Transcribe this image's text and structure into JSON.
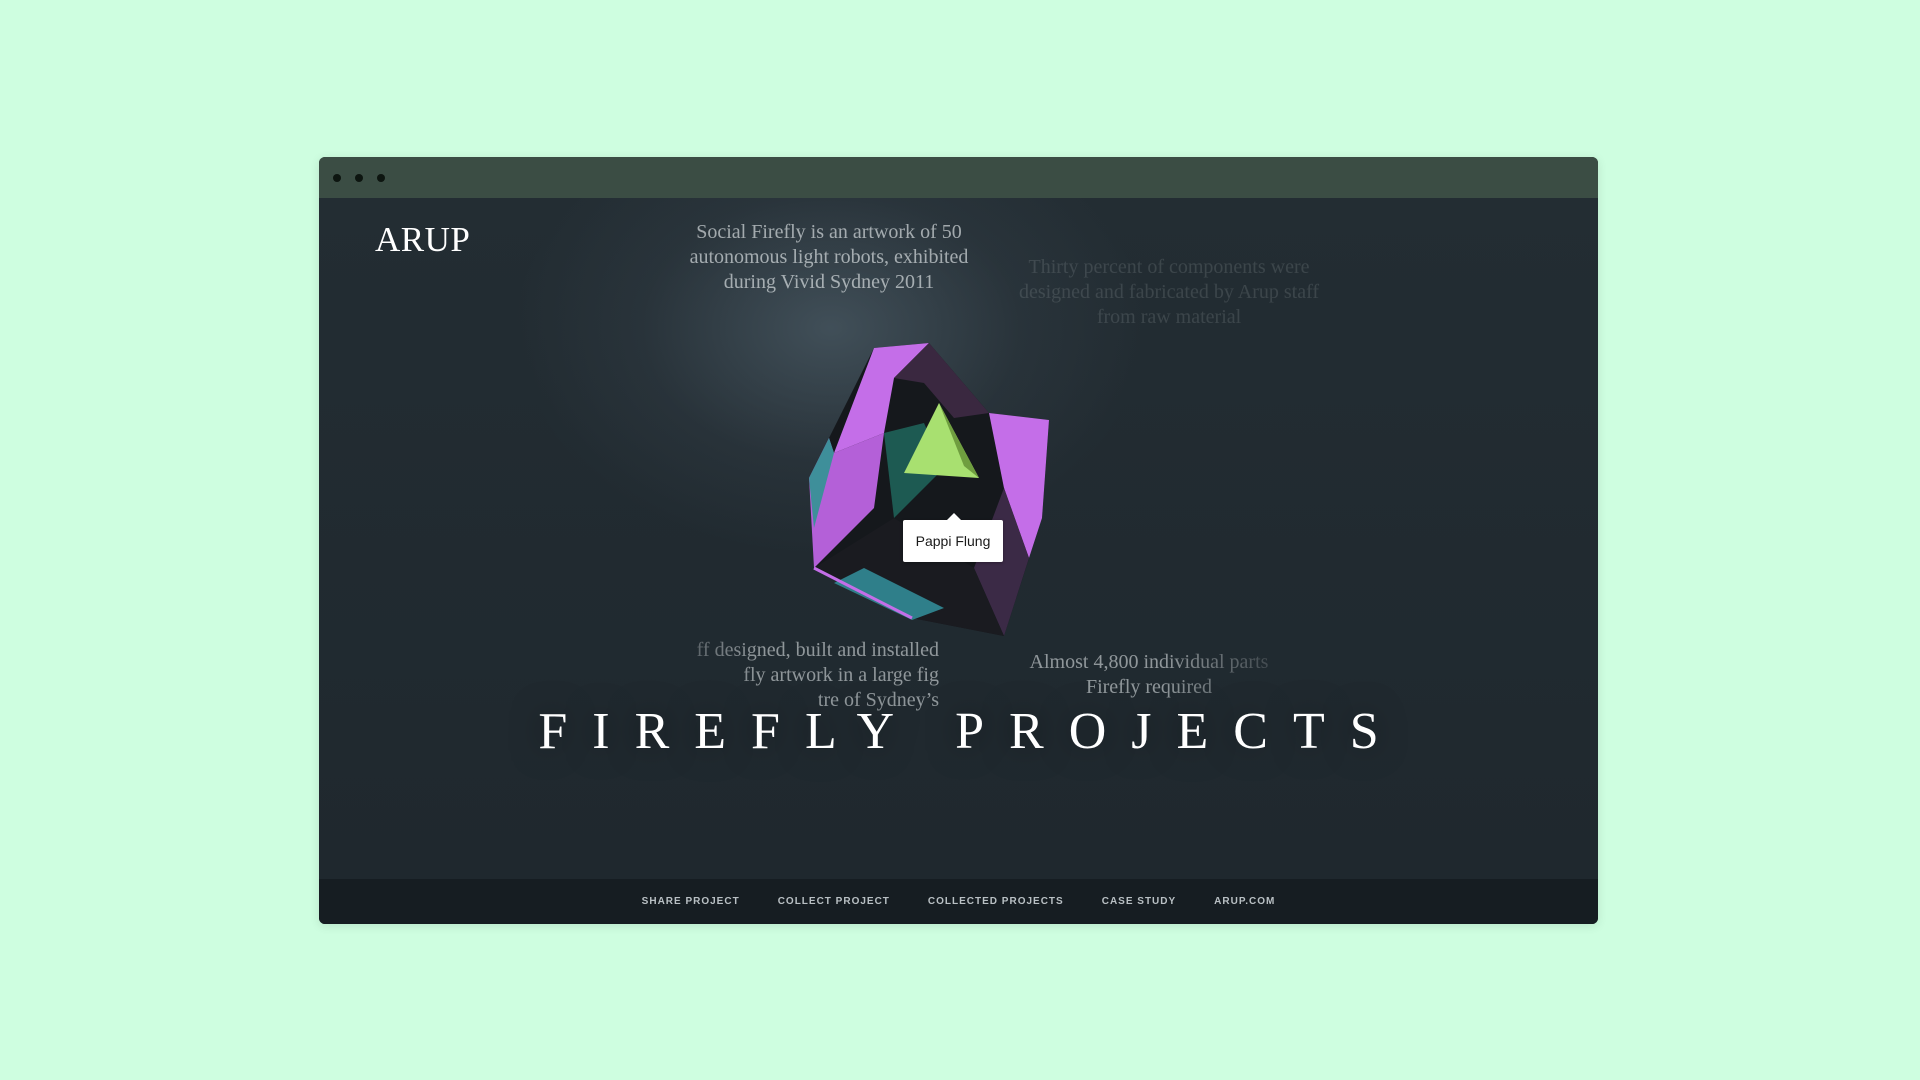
{
  "brand": {
    "logo": "ARUP"
  },
  "facts": [
    "Social Firefly is an artwork of 50\nautonomous light robots, exhibited\nduring Vivid Sydney 2011",
    "Thirty percent of components were\ndesigned and fabricated by Arup staff\nfrom raw material",
    "ff designed, built and installed\nfly artwork in a large fig\ntre of Sydney’s",
    "Almost 4,800 individual parts\nFirefly required"
  ],
  "tooltip": {
    "label": "Pappi Flung"
  },
  "title": "FIREFLY PROJECTS",
  "nav": [
    {
      "label": "SHARE PROJECT"
    },
    {
      "label": "COLLECT PROJECT"
    },
    {
      "label": "COLLECTED PROJECTS"
    },
    {
      "label": "CASE STUDY"
    },
    {
      "label": "ARUP.COM"
    }
  ],
  "colors": {
    "page_background": "#cefee0",
    "window_title_bar": "#3b4d44",
    "viewport_background": "#1f272d",
    "footer_background": "#161d22",
    "crystal_purple": "#c46ee8",
    "crystal_green": "#a8e070"
  }
}
